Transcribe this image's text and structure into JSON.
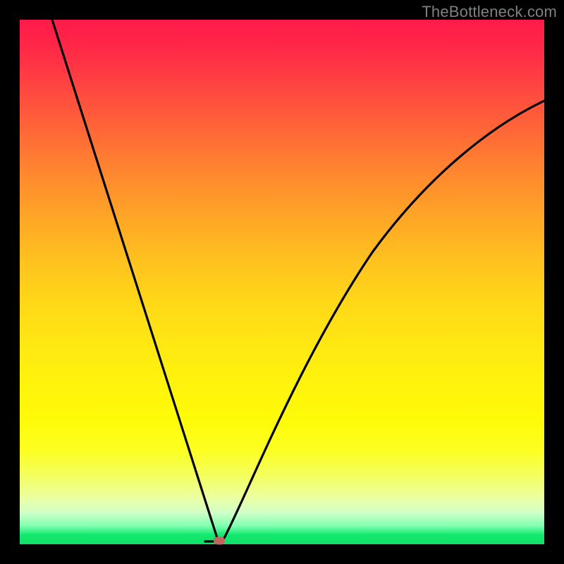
{
  "watermark": "TheBottleneck.com",
  "chart_data": {
    "type": "line",
    "title": "",
    "xlabel": "",
    "ylabel": "",
    "xlim": [
      0,
      1
    ],
    "ylim": [
      0,
      1
    ],
    "x": [
      0.0,
      0.05,
      0.1,
      0.15,
      0.2,
      0.25,
      0.3,
      0.34,
      0.36,
      0.37,
      0.4,
      0.45,
      0.5,
      0.55,
      0.6,
      0.65,
      0.7,
      0.75,
      0.8,
      0.85,
      0.9,
      0.95,
      1.0
    ],
    "values": [
      1.0,
      0.865,
      0.73,
      0.595,
      0.46,
      0.325,
      0.19,
      0.075,
      0.02,
      0.0,
      0.055,
      0.175,
      0.285,
      0.385,
      0.47,
      0.545,
      0.61,
      0.665,
      0.715,
      0.755,
      0.79,
      0.82,
      0.845
    ],
    "marker": {
      "x": 0.37,
      "y": 0.0
    },
    "background": "rainbow-vertical-gradient"
  }
}
